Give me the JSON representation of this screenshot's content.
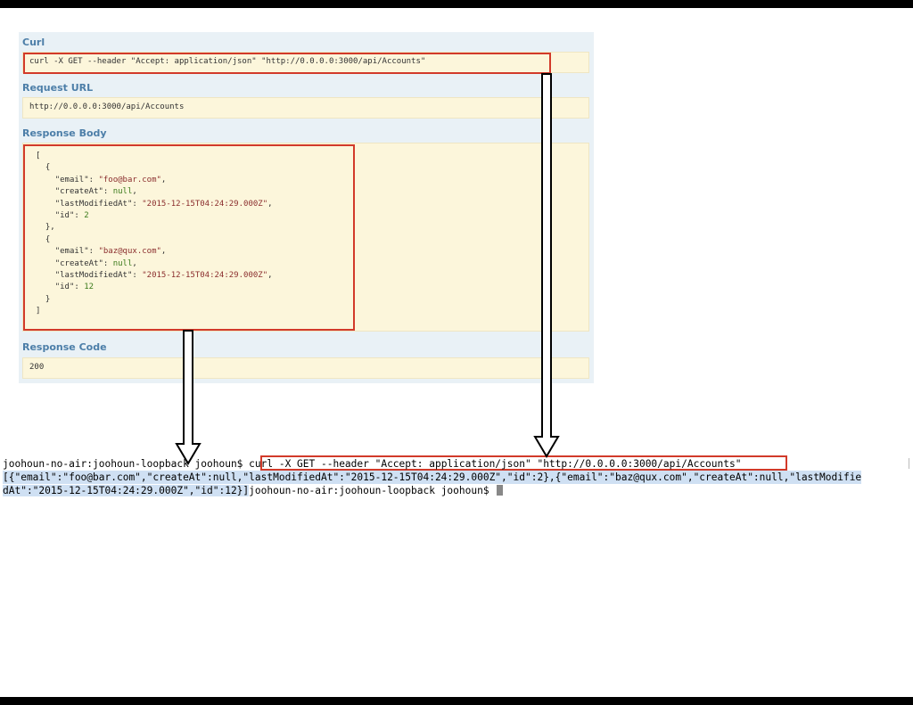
{
  "curl": {
    "label": "Curl",
    "command": "curl -X GET --header \"Accept: application/json\" \"http://0.0.0.0:3000/api/Accounts\""
  },
  "request_url": {
    "label": "Request URL",
    "value": "http://0.0.0.0:3000/api/Accounts"
  },
  "response_body": {
    "label": "Response Body",
    "lines": [
      {
        "p1": "[",
        "k": "",
        "v": "",
        "p2": ""
      },
      {
        "p1": "  {",
        "k": "",
        "v": "",
        "p2": ""
      },
      {
        "p1": "    ",
        "k": "\"email\": ",
        "v": "\"foo@bar.com\"",
        "p2": ","
      },
      {
        "p1": "    ",
        "k": "\"createAt\": ",
        "v": "null",
        "p2": ","
      },
      {
        "p1": "    ",
        "k": "\"lastModifiedAt\": ",
        "v": "\"2015-12-15T04:24:29.000Z\"",
        "p2": ","
      },
      {
        "p1": "    ",
        "k": "\"id\": ",
        "v": "2",
        "p2": ""
      },
      {
        "p1": "  },",
        "k": "",
        "v": "",
        "p2": ""
      },
      {
        "p1": "  {",
        "k": "",
        "v": "",
        "p2": ""
      },
      {
        "p1": "    ",
        "k": "\"email\": ",
        "v": "\"baz@qux.com\"",
        "p2": ","
      },
      {
        "p1": "    ",
        "k": "\"createAt\": ",
        "v": "null",
        "p2": ","
      },
      {
        "p1": "    ",
        "k": "\"lastModifiedAt\": ",
        "v": "\"2015-12-15T04:24:29.000Z\"",
        "p2": ","
      },
      {
        "p1": "    ",
        "k": "\"id\": ",
        "v": "12",
        "p2": ""
      },
      {
        "p1": "  }",
        "k": "",
        "v": "",
        "p2": ""
      },
      {
        "p1": "]",
        "k": "",
        "v": "",
        "p2": ""
      }
    ]
  },
  "response_code": {
    "label": "Response Code",
    "value": "200"
  },
  "terminal": {
    "prompt": "joohoun-no-air:joohoun-loopback joohoun$ ",
    "command": "curl -X GET --header \"Accept: application/json\" \"http://0.0.0.0:3000/api/Accounts\"",
    "output_line1": "[{\"email\":\"foo@bar.com\",\"createAt\":null,\"lastModifiedAt\":\"2015-12-15T04:24:29.000Z\",\"id\":2},{\"email\":\"baz@qux.com\",\"createAt\":null,\"lastModifie",
    "output_line2": "dAt\":\"2015-12-15T04:24:29.000Z\",\"id\":12}]",
    "prompt2": "joohoun-no-air:joohoun-loopback joohoun$ "
  },
  "colors": {
    "highlight": "#d23a2a",
    "label": "#4c7ea8",
    "code_bg": "#fcf6db",
    "selection": "#cfe0f3"
  }
}
